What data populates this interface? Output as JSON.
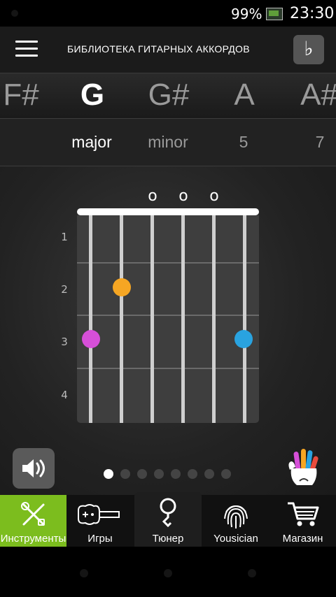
{
  "status": {
    "battery_percent": "99%",
    "time": "23:30"
  },
  "app_bar": {
    "title": "БИБЛИОТЕКА ГИТАРНЫХ АККОРДОВ",
    "flat_symbol": "♭"
  },
  "keys": [
    "F#",
    "G",
    "G#",
    "A",
    "A#"
  ],
  "selected_key": "G",
  "chord_types": [
    "major",
    "minor",
    "5",
    "7"
  ],
  "selected_chord_type": "major",
  "chord": {
    "open_string_mark": "o",
    "fret_numbers": [
      "1",
      "2",
      "3",
      "4"
    ],
    "finger_colors": {
      "orange": "#f6a623",
      "magenta": "#d64fd8",
      "blue": "#29a3e0"
    }
  },
  "pager": {
    "count": 8,
    "active_index": 0
  },
  "tabs": [
    {
      "label": "Инструменты",
      "icon": "tools-icon"
    },
    {
      "label": "Игры",
      "icon": "guitar-icon"
    },
    {
      "label": "Тюнер",
      "icon": "tuner-icon"
    },
    {
      "label": "Yousician",
      "icon": "fingerprint-icon"
    },
    {
      "label": "Магазин",
      "icon": "cart-icon"
    }
  ],
  "colors": {
    "accent": "#7cbd1e"
  }
}
